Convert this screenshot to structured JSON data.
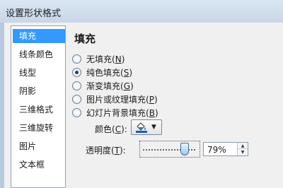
{
  "window": {
    "title": "设置形状格式"
  },
  "sidebar": {
    "items": [
      {
        "label": "填充",
        "selected": true
      },
      {
        "label": "线条颜色",
        "selected": false
      },
      {
        "label": "线型",
        "selected": false
      },
      {
        "label": "阴影",
        "selected": false
      },
      {
        "label": "三维格式",
        "selected": false
      },
      {
        "label": "三维旋转",
        "selected": false
      },
      {
        "label": "图片",
        "selected": false
      },
      {
        "label": "文本框",
        "selected": false
      }
    ]
  },
  "fill": {
    "heading": "填充",
    "options": [
      {
        "label": "无填充",
        "key": "N",
        "checked": false
      },
      {
        "label": "纯色填充",
        "key": "S",
        "checked": true
      },
      {
        "label": "渐变填充",
        "key": "G",
        "checked": false
      },
      {
        "label": "图片或纹理填充",
        "key": "P",
        "checked": false
      },
      {
        "label": "幻灯片背景填充",
        "key": "B",
        "checked": false
      }
    ],
    "color_label": "颜色",
    "color_key": "C",
    "color_suffix": ":",
    "transparency_label": "透明度",
    "transparency_key": "T",
    "transparency_suffix": ":",
    "transparency_value": "79%",
    "transparency_fraction": 0.79
  },
  "icons": {
    "color_button": "paint-bucket-icon",
    "dropdown": "triangle-down-icon",
    "spin_up": "spin-up-icon",
    "spin_down": "spin-down-icon"
  },
  "colors": {
    "selection": "#3399ff",
    "titlebar": "#c7d6e8",
    "panel": "#f0f0f0"
  }
}
